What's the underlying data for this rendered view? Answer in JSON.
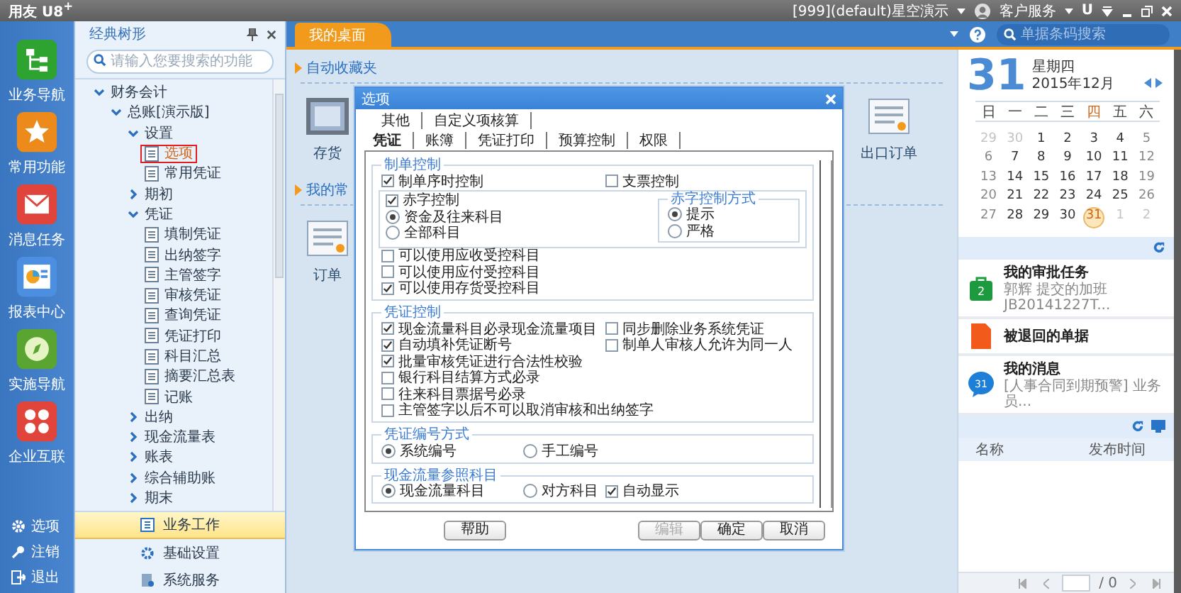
{
  "title_bar": {
    "app_name": "用友 U8$^{+}$",
    "account": "[999](default)星空演示",
    "service": "客户服务",
    "update_key": "U"
  },
  "nav": {
    "items": [
      {
        "label": "业务导航"
      },
      {
        "label": "常用功能"
      },
      {
        "label": "消息任务"
      },
      {
        "label": "报表中心"
      },
      {
        "label": "实施导航"
      },
      {
        "label": "企业互联"
      }
    ],
    "bottom": [
      {
        "label": "选项"
      },
      {
        "label": "注销"
      },
      {
        "label": "退出"
      }
    ]
  },
  "tree_panel": {
    "title": "经典树形",
    "search": {
      "placeholder": "请输入您要搜索的功能"
    },
    "tree": [
      {
        "label": "财务会计",
        "kind": "folder",
        "expanded": true,
        "selected": false,
        "children": [
          {
            "label": "总账[演示版]",
            "kind": "folder",
            "expanded": true,
            "selected": false,
            "children": [
              {
                "label": "设置",
                "kind": "folder",
                "expanded": true,
                "selected": false,
                "children": [
                  {
                    "label": "选项",
                    "kind": "leaf",
                    "selected": true
                  },
                  {
                    "label": "常用凭证",
                    "kind": "leaf",
                    "selected": false
                  }
                ]
              },
              {
                "label": "期初",
                "kind": "folder",
                "expanded": false,
                "selected": false
              },
              {
                "label": "凭证",
                "kind": "folder",
                "expanded": true,
                "selected": false,
                "children": [
                  {
                    "label": "填制凭证",
                    "kind": "leaf",
                    "selected": false
                  },
                  {
                    "label": "出纳签字",
                    "kind": "leaf",
                    "selected": false
                  },
                  {
                    "label": "主管签字",
                    "kind": "leaf",
                    "selected": false
                  },
                  {
                    "label": "审核凭证",
                    "kind": "leaf",
                    "selected": false
                  },
                  {
                    "label": "查询凭证",
                    "kind": "leaf",
                    "selected": false
                  },
                  {
                    "label": "凭证打印",
                    "kind": "leaf",
                    "selected": false
                  },
                  {
                    "label": "科目汇总",
                    "kind": "leaf",
                    "selected": false
                  },
                  {
                    "label": "摘要汇总表",
                    "kind": "leaf",
                    "selected": false
                  },
                  {
                    "label": "记账",
                    "kind": "leaf",
                    "selected": false
                  }
                ]
              },
              {
                "label": "出纳",
                "kind": "folder",
                "expanded": false,
                "selected": false
              },
              {
                "label": "现金流量表",
                "kind": "folder",
                "expanded": false,
                "selected": false
              },
              {
                "label": "账表",
                "kind": "folder",
                "expanded": false,
                "selected": false
              },
              {
                "label": "综合辅助账",
                "kind": "folder",
                "expanded": false,
                "selected": false
              },
              {
                "label": "期末",
                "kind": "folder",
                "expanded": false,
                "selected": false
              }
            ]
          }
        ]
      }
    ],
    "modules": [
      {
        "label": "业务工作",
        "selected": true
      },
      {
        "label": "基础设置",
        "selected": false
      },
      {
        "label": "系统服务",
        "selected": false
      }
    ]
  },
  "tabs": [
    {
      "label": "我的桌面",
      "selected": true
    }
  ],
  "barcode_search": {
    "placeholder": "单据条码搜索"
  },
  "desktop": {
    "sections": [
      {
        "title": "自动收藏夹",
        "items": [
          {
            "label": "存货"
          },
          {
            "label": "出口订单"
          }
        ]
      },
      {
        "title": "我的常",
        "items": [
          {
            "label": "订单"
          }
        ]
      }
    ]
  },
  "dialog": {
    "title": "选项",
    "tabs_row1": [
      {
        "label": "其他",
        "selected": false
      },
      {
        "label": "自定义项核算",
        "selected": false
      }
    ],
    "tabs_row2": [
      {
        "label": "凭证",
        "selected": true
      },
      {
        "label": "账簿",
        "selected": false
      },
      {
        "label": "凭证打印",
        "selected": false
      },
      {
        "label": "预算控制",
        "selected": false
      },
      {
        "label": "权限",
        "selected": false
      }
    ],
    "groups": [
      {
        "title": "制单控制",
        "items": [
          {
            "kind": "row",
            "cells": [
              {
                "kind": "checkbox",
                "label": "制单序时控制",
                "checked": true
              },
              {
                "kind": "checkbox",
                "label": "支票控制",
                "checked": false
              }
            ]
          },
          {
            "kind": "panel",
            "cells": [
              {
                "kind": "checkbox",
                "label": "赤字控制",
                "checked": true
              },
              {
                "kind": "radio",
                "label": "资金及往来科目",
                "selected": true
              },
              {
                "kind": "radio",
                "label": "全部科目",
                "selected": false
              }
            ],
            "sub": {
              "title": "赤字控制方式",
              "cells": [
                {
                  "kind": "radio",
                  "label": "提示",
                  "selected": true
                },
                {
                  "kind": "radio",
                  "label": "严格",
                  "selected": false
                }
              ]
            }
          },
          {
            "kind": "row",
            "cells": [
              {
                "kind": "checkbox",
                "label": "可以使用应收受控科目",
                "checked": false
              }
            ]
          },
          {
            "kind": "row",
            "cells": [
              {
                "kind": "checkbox",
                "label": "可以使用应付受控科目",
                "checked": false
              }
            ]
          },
          {
            "kind": "row",
            "cells": [
              {
                "kind": "checkbox",
                "label": "可以使用存货受控科目",
                "checked": true
              }
            ]
          }
        ]
      },
      {
        "title": "凭证控制",
        "items": [
          {
            "kind": "row",
            "cells": [
              {
                "kind": "checkbox",
                "label": "现金流量科目必录现金流量项目",
                "checked": true
              },
              {
                "kind": "checkbox",
                "label": "同步删除业务系统凭证",
                "checked": false
              }
            ]
          },
          {
            "kind": "row",
            "cells": [
              {
                "kind": "checkbox",
                "label": "自动填补凭证断号",
                "checked": true
              },
              {
                "kind": "checkbox",
                "label": "制单人审核人允许为同一人",
                "checked": false
              }
            ]
          },
          {
            "kind": "row",
            "cells": [
              {
                "kind": "checkbox",
                "label": "批量审核凭证进行合法性校验",
                "checked": true
              }
            ]
          },
          {
            "kind": "row",
            "cells": [
              {
                "kind": "checkbox",
                "label": "银行科目结算方式必录",
                "checked": false
              }
            ]
          },
          {
            "kind": "row",
            "cells": [
              {
                "kind": "checkbox",
                "label": "往来科目票据号必录",
                "checked": false
              }
            ]
          },
          {
            "kind": "row",
            "cells": [
              {
                "kind": "checkbox",
                "label": "主管签字以后不可以取消审核和出纳签字",
                "checked": false
              }
            ]
          }
        ]
      },
      {
        "title": "凭证编号方式",
        "items": [
          {
            "kind": "row",
            "cells": [
              {
                "kind": "radio",
                "label": "系统编号",
                "selected": true
              },
              {
                "kind": "radio",
                "label": "手工编号",
                "selected": false
              }
            ]
          }
        ]
      },
      {
        "title": "现金流量参照科目",
        "items": [
          {
            "kind": "row",
            "cells": [
              {
                "kind": "radio",
                "label": "现金流量科目",
                "selected": true
              },
              {
                "kind": "radio",
                "label": "对方科目",
                "selected": false
              },
              {
                "kind": "checkbox",
                "label": "自动显示",
                "checked": true
              }
            ]
          }
        ]
      }
    ],
    "buttons": [
      {
        "label": "帮助",
        "disabled": false
      },
      {
        "label": "编辑",
        "disabled": true
      },
      {
        "label": "确定",
        "disabled": false
      },
      {
        "label": "取消",
        "disabled": false
      }
    ]
  },
  "calendar": {
    "day": "31",
    "weekday": "星期四",
    "month": "2015年12月",
    "weekdays": [
      {
        "label": "日",
        "selected": false
      },
      {
        "label": "一",
        "selected": false
      },
      {
        "label": "二",
        "selected": false
      },
      {
        "label": "三",
        "selected": false
      },
      {
        "label": "四",
        "selected": true
      },
      {
        "label": "五",
        "selected": false
      },
      {
        "label": "六",
        "selected": false
      }
    ],
    "days": [
      {
        "label": "29",
        "muted": true,
        "selected": false
      },
      {
        "label": "30",
        "muted": true,
        "selected": false
      },
      {
        "label": "1",
        "muted": false,
        "selected": false
      },
      {
        "label": "2",
        "muted": false,
        "selected": false
      },
      {
        "label": "3",
        "muted": false,
        "selected": false
      },
      {
        "label": "4",
        "muted": false,
        "selected": false
      },
      {
        "label": "5",
        "muted": false,
        "selected": false
      },
      {
        "label": "6",
        "muted": false,
        "selected": false
      },
      {
        "label": "7",
        "muted": false,
        "selected": false
      },
      {
        "label": "8",
        "muted": false,
        "selected": false
      },
      {
        "label": "9",
        "muted": false,
        "selected": false
      },
      {
        "label": "10",
        "muted": false,
        "selected": false
      },
      {
        "label": "11",
        "muted": false,
        "selected": false
      },
      {
        "label": "12",
        "muted": false,
        "selected": false
      },
      {
        "label": "13",
        "muted": false,
        "selected": false
      },
      {
        "label": "14",
        "muted": false,
        "selected": false
      },
      {
        "label": "15",
        "muted": false,
        "selected": false
      },
      {
        "label": "16",
        "muted": false,
        "selected": false
      },
      {
        "label": "17",
        "muted": false,
        "selected": false
      },
      {
        "label": "18",
        "muted": false,
        "selected": false
      },
      {
        "label": "19",
        "muted": false,
        "selected": false
      },
      {
        "label": "20",
        "muted": false,
        "selected": false
      },
      {
        "label": "21",
        "muted": false,
        "selected": false
      },
      {
        "label": "22",
        "muted": false,
        "selected": false
      },
      {
        "label": "23",
        "muted": false,
        "selected": false
      },
      {
        "label": "24",
        "muted": false,
        "selected": false
      },
      {
        "label": "25",
        "muted": false,
        "selected": false
      },
      {
        "label": "26",
        "muted": false,
        "selected": false
      },
      {
        "label": "27",
        "muted": false,
        "selected": false
      },
      {
        "label": "28",
        "muted": false,
        "selected": false
      },
      {
        "label": "29",
        "muted": false,
        "selected": false
      },
      {
        "label": "30",
        "muted": false,
        "selected": false
      },
      {
        "label": "31",
        "muted": false,
        "selected": true
      },
      {
        "label": "1",
        "muted": true,
        "selected": false
      },
      {
        "label": "2",
        "muted": true,
        "selected": false
      }
    ]
  },
  "tasks": [
    {
      "title": "我的审批任务",
      "detail": "郭辉 提交的加班 JB20141227T...",
      "badge": "2"
    },
    {
      "title": "被退回的单据"
    },
    {
      "title": "我的消息",
      "detail": "[人事合同到期预警] 业务员...",
      "badge": "31"
    }
  ],
  "notices": {
    "columns": [
      "名称",
      "发布时间"
    ],
    "pager": "/ 0"
  }
}
